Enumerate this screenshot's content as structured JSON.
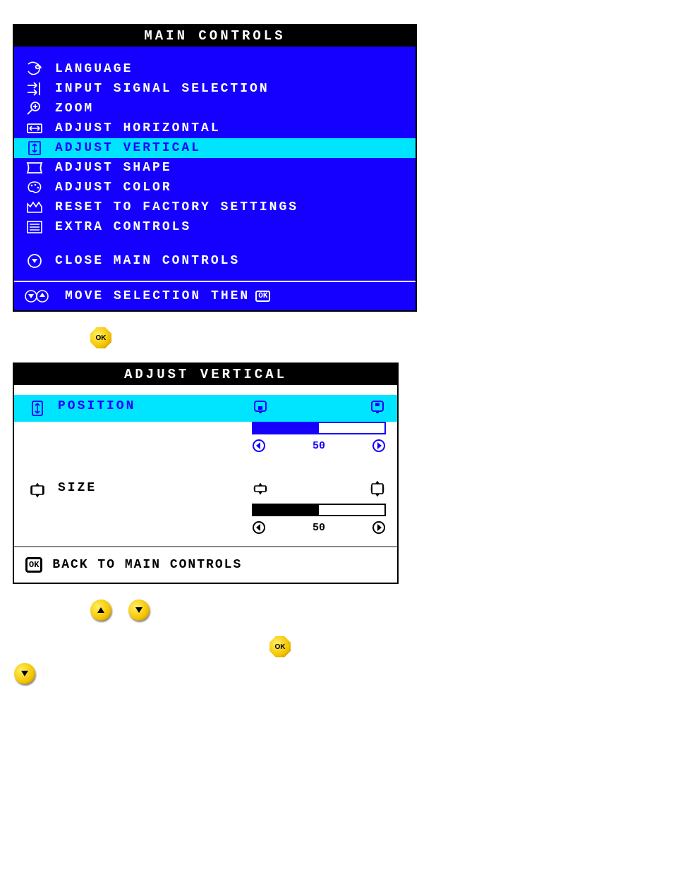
{
  "main_controls": {
    "title": "MAIN CONTROLS",
    "items": [
      {
        "icon": "language-icon",
        "label": "LANGUAGE",
        "highlight": false
      },
      {
        "icon": "input-signal-icon",
        "label": "INPUT SIGNAL SELECTION",
        "highlight": false
      },
      {
        "icon": "zoom-icon",
        "label": "ZOOM",
        "highlight": false
      },
      {
        "icon": "adjust-horizontal-icon",
        "label": "ADJUST HORIZONTAL",
        "highlight": false
      },
      {
        "icon": "adjust-vertical-icon",
        "label": "ADJUST VERTICAL",
        "highlight": true
      },
      {
        "icon": "adjust-shape-icon",
        "label": "ADJUST SHAPE",
        "highlight": false
      },
      {
        "icon": "adjust-color-icon",
        "label": "ADJUST COLOR",
        "highlight": false
      },
      {
        "icon": "reset-factory-icon",
        "label": "RESET TO FACTORY SETTINGS",
        "highlight": false
      },
      {
        "icon": "extra-controls-icon",
        "label": "EXTRA CONTROLS",
        "highlight": false
      }
    ],
    "close": {
      "icon": "close-menu-icon",
      "label": "CLOSE MAIN CONTROLS"
    },
    "footer": {
      "text": "MOVE SELECTION THEN",
      "ok_text": "OK"
    }
  },
  "button_ok": "OK",
  "adjust_vertical": {
    "title": "ADJUST VERTICAL",
    "position": {
      "label": "POSITION",
      "value": 50,
      "bar_percent": 50,
      "highlight": true
    },
    "size": {
      "label": "SIZE",
      "value": 50,
      "bar_percent": 50,
      "highlight": false
    },
    "footer": "BACK TO MAIN CONTROLS"
  }
}
